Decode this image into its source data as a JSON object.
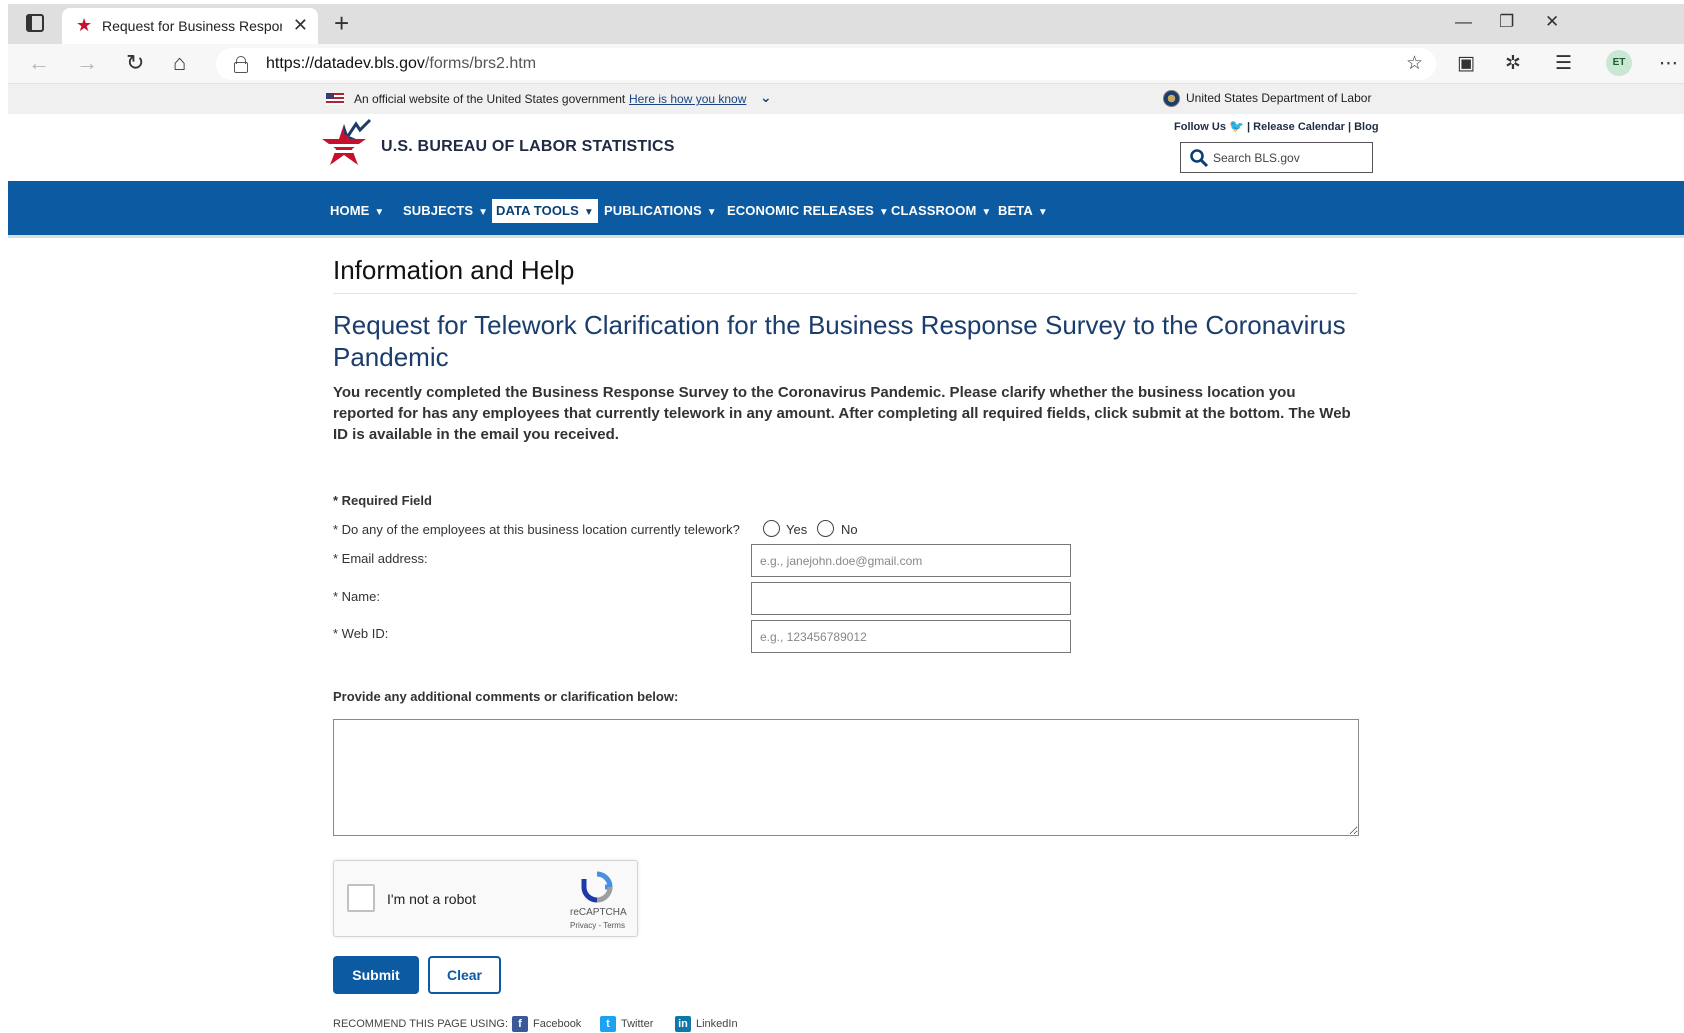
{
  "browser": {
    "tab_title": "Request for Business Response Survey",
    "new_tab": "+",
    "url_host": "https://datadev.bls.gov",
    "url_path": "/forms/brs2.htm",
    "avatar": "ET"
  },
  "gov_banner": {
    "text": "An official website of the United States government",
    "link": "Here is how you know",
    "dol": "United States Department of Labor"
  },
  "header": {
    "agency": "U.S. BUREAU OF LABOR STATISTICS",
    "follow": "Follow Us",
    "release_calendar": "Release Calendar",
    "blog": "Blog",
    "search_placeholder": "Search BLS.gov"
  },
  "nav": [
    {
      "label": "HOME"
    },
    {
      "label": "SUBJECTS"
    },
    {
      "label": "DATA TOOLS",
      "active": true
    },
    {
      "label": "PUBLICATIONS"
    },
    {
      "label": "ECONOMIC RELEASES"
    },
    {
      "label": "CLASSROOM"
    },
    {
      "label": "BETA"
    }
  ],
  "page": {
    "heading": "Information and Help",
    "form_title": "Request for Telework Clarification for the Business Response Survey to the Coronavirus Pandemic",
    "intro": "You recently completed the Business Response Survey to the Coronavirus Pandemic. Please clarify whether the business location you reported for has any employees that currently telework in any amount. After completing all required fields, click submit at the bottom. The Web ID is available in the email you received."
  },
  "form": {
    "required_note": "* Required Field",
    "telework_question": "* Do any of the employees at this business location currently telework?",
    "yes": "Yes",
    "no": "No",
    "email_label": "*  Email address:",
    "email_placeholder": "e.g., janejohn.doe@gmail.com",
    "name_label": "*  Name:",
    "webid_label": "*  Web ID:",
    "webid_placeholder": "e.g., 123456789012",
    "comments_label": "Provide any additional comments or clarification below:",
    "captcha_text": "I'm not a robot",
    "captcha_brand": "reCAPTCHA",
    "captcha_terms": "Privacy - Terms",
    "submit": "Submit",
    "clear": "Clear"
  },
  "footer": {
    "recommend": "RECOMMEND THIS PAGE USING:",
    "facebook": "Facebook",
    "twitter": "Twitter",
    "linkedin": "LinkedIn"
  },
  "colors": {
    "nav_blue": "#0b5aa2",
    "title_blue": "#1a3d6d",
    "logo_red": "#c8102e"
  }
}
